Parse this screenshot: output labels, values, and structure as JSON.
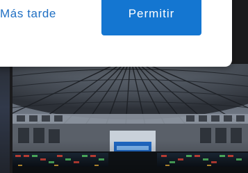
{
  "prompt": {
    "later_label": "Más tarde",
    "allow_label": "Permitir"
  },
  "colors": {
    "accent": "#1476d1",
    "link": "#1f6fc3",
    "card_bg": "#ffffff",
    "page_bg": "#1b1b1d"
  }
}
